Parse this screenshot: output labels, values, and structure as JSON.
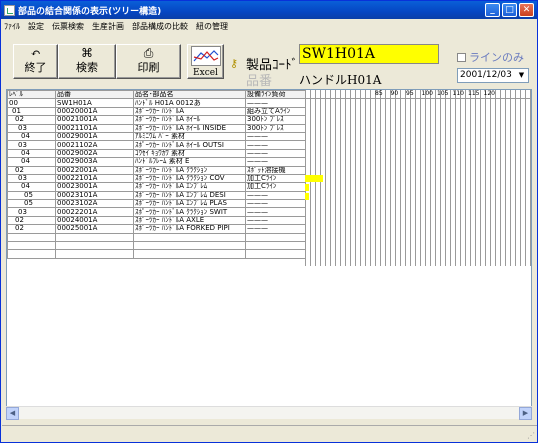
{
  "window": {
    "title": "部品の結合関係の表示(ツリー構造)"
  },
  "menu": [
    "ﾌｧｲﾙ",
    "設定",
    "伝票検索",
    "生産計画",
    "部品構成の比較",
    "紐の管理"
  ],
  "toolbar": {
    "exit_label": "終了",
    "search_label": "検索",
    "print_label": "印刷",
    "excel_label": "Excel"
  },
  "product": {
    "code_label": "製品ｺｰﾄﾞ",
    "code_value": "SW1H01A",
    "name_label": "品番",
    "name_value": "ハンドルH01A"
  },
  "line_only_label": "ラインのみ",
  "date_value": "2001/12/03",
  "grid": {
    "headers": [
      "ﾚﾍﾞﾙ",
      "品番",
      "品名･部品名",
      "設備ﾗｲﾝ負荷"
    ],
    "rows": [
      [
        "00",
        "SW1H01A",
        "ﾊﾝﾄﾞﾙ H01A 0012あ",
        "———"
      ],
      [
        "01",
        "00020001A",
        "ｽﾎﾟｰﾂｶｰ ﾊﾝﾄﾞﾙA",
        "組み立てAﾗｲﾝ"
      ],
      [
        "02",
        "00021001A",
        "ｽﾎﾟｰﾂｶｰ ﾊﾝﾄﾞﾙA ﾎｲｰﾙ",
        "300ﾄﾝ ﾌﾟﾚｽ"
      ],
      [
        "03",
        "00021101A",
        "ｽﾎﾟｰﾂｶｰ ﾊﾝﾄﾞﾙA ﾎｲｰﾙ INSIDE",
        "300ﾄﾝ ﾌﾟﾚｽ"
      ],
      [
        "04",
        "00029001A",
        "ｱﾙﾐﾆｳﾑ ﾊﾞｰ 素材",
        "———"
      ],
      [
        "03",
        "00021102A",
        "ｽﾎﾟｰﾂｶｰ ﾊﾝﾄﾞﾙA ﾎｲｰﾙ OUTSI",
        "———"
      ],
      [
        "04",
        "00029002A",
        "ｺｳｾｲ ｷｮｳｶﾜ 素材",
        "———"
      ],
      [
        "04",
        "00029003A",
        "ﾊﾝﾄﾞﾙﾌﾚｰﾑ 素材 E",
        "———"
      ],
      [
        "02",
        "00022001A",
        "ｽﾎﾟｰﾂｶｰ ﾊﾝﾄﾞﾙA ｸﾗｸｼｮﾝ",
        "ｽﾎﾟｯﾄ溶接機"
      ],
      [
        "03",
        "00022101A",
        "ｽﾎﾟｰﾂｶｰ ﾊﾝﾄﾞﾙA ｸﾗｸｼｮﾝ COV",
        "加工Cﾗｲﾝ"
      ],
      [
        "04",
        "00023001A",
        "ｽﾎﾟｰﾂｶｰ ﾊﾝﾄﾞﾙA ｴﾝﾌﾞﾚﾑ",
        "加工Cﾗｲﾝ"
      ],
      [
        "05",
        "00023101A",
        "ｽﾎﾟｰﾂｶｰ ﾊﾝﾄﾞﾙA ｴﾝﾌﾞﾚﾑ DESI",
        "———"
      ],
      [
        "05",
        "00023102A",
        "ｽﾎﾟｰﾂｶｰ ﾊﾝﾄﾞﾙA ｴﾝﾌﾞﾚﾑ PLAS",
        "———"
      ],
      [
        "03",
        "00022201A",
        "ｽﾎﾟｰﾂｶｰ ﾊﾝﾄﾞﾙA ｸﾗｸｼｮﾝ SWIT",
        "———"
      ],
      [
        "02",
        "00024001A",
        "ｽﾎﾟｰﾂｶｰ ﾊﾝﾄﾞﾙA AXLE",
        "———"
      ],
      [
        "02",
        "00025001A",
        "ｽﾎﾟｰﾂｶｰ ﾊﾝﾄﾞﾙA FORKED PIPI",
        "———"
      ]
    ],
    "timeline_labels": [
      "85",
      "90",
      "95",
      "100",
      "105",
      "110",
      "115",
      "120"
    ],
    "load_bars": [
      {
        "row": 8,
        "level": 0.7
      },
      {
        "row": 9,
        "level": 0.15
      },
      {
        "row": 10,
        "level": 0.15
      }
    ]
  },
  "icons": {
    "exit": "undo-arrow-icon",
    "search": "binoculars-icon",
    "print": "printer-icon",
    "excel": "excel-chart-icon",
    "help": "key-icon"
  }
}
